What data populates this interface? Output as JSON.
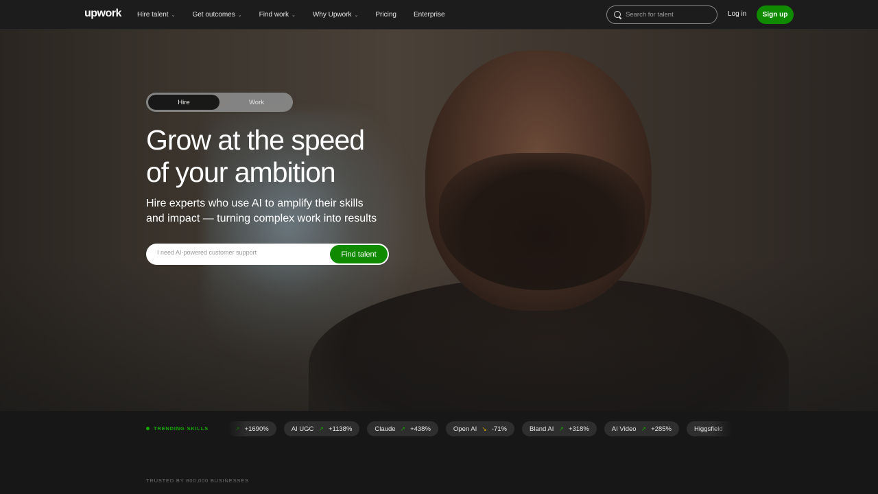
{
  "nav": {
    "logo": "upwork",
    "items": [
      {
        "label": "Hire talent",
        "has_dropdown": true
      },
      {
        "label": "Get outcomes",
        "has_dropdown": true
      },
      {
        "label": "Find work",
        "has_dropdown": true
      },
      {
        "label": "Why Upwork",
        "has_dropdown": true
      },
      {
        "label": "Pricing",
        "has_dropdown": false
      },
      {
        "label": "Enterprise",
        "has_dropdown": false
      }
    ],
    "search_placeholder": "Search for talent",
    "login": "Log in",
    "signup": "Sign up"
  },
  "hero": {
    "toggle": {
      "hire": "Hire",
      "work": "Work",
      "selected": "Hire"
    },
    "headline_line1": "Grow at the speed",
    "headline_line2": "of your ambition",
    "subhead_line1": "Hire experts who use AI to amplify their skills",
    "subhead_line2": "and impact — turning complex work into results",
    "search_placeholder": "I need AI-powered customer support",
    "cta": "Find talent"
  },
  "trending": {
    "label": "TRENDING SKILLS",
    "chips": [
      {
        "name": "",
        "change": "+1690%",
        "direction": "up"
      },
      {
        "name": "AI UGC",
        "change": "+1138%",
        "direction": "up"
      },
      {
        "name": "Claude",
        "change": "+438%",
        "direction": "up"
      },
      {
        "name": "Open AI",
        "change": "-71%",
        "direction": "down"
      },
      {
        "name": "Bland AI",
        "change": "+318%",
        "direction": "up"
      },
      {
        "name": "AI Video",
        "change": "+285%",
        "direction": "up"
      },
      {
        "name": "Higgsfield",
        "change": "",
        "direction": "up"
      }
    ]
  },
  "trusted": "TRUSTED BY 800,000 BUSINESSES",
  "colors": {
    "accent": "#108a00",
    "trend_up": "#14a800",
    "trend_down": "#d2b100"
  }
}
